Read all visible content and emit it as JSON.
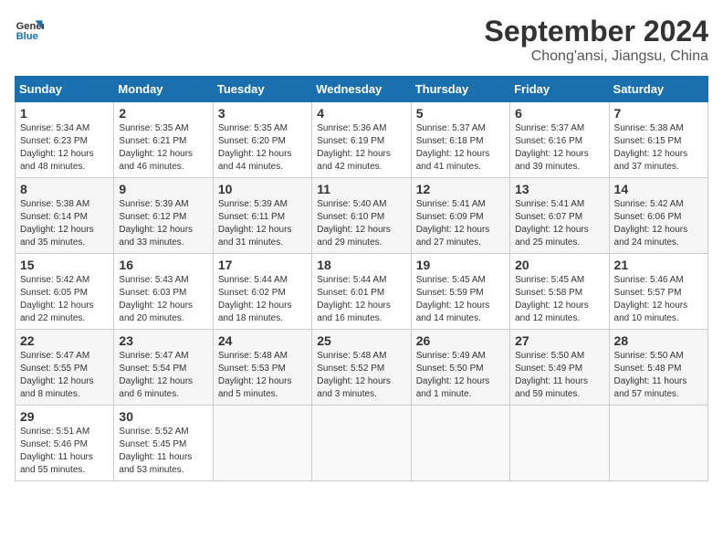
{
  "logo": {
    "line1": "General",
    "line2": "Blue"
  },
  "title": "September 2024",
  "location": "Chong'ansi, Jiangsu, China",
  "weekdays": [
    "Sunday",
    "Monday",
    "Tuesday",
    "Wednesday",
    "Thursday",
    "Friday",
    "Saturday"
  ],
  "weeks": [
    [
      {
        "day": "1",
        "info": "Sunrise: 5:34 AM\nSunset: 6:23 PM\nDaylight: 12 hours\nand 48 minutes."
      },
      {
        "day": "2",
        "info": "Sunrise: 5:35 AM\nSunset: 6:21 PM\nDaylight: 12 hours\nand 46 minutes."
      },
      {
        "day": "3",
        "info": "Sunrise: 5:35 AM\nSunset: 6:20 PM\nDaylight: 12 hours\nand 44 minutes."
      },
      {
        "day": "4",
        "info": "Sunrise: 5:36 AM\nSunset: 6:19 PM\nDaylight: 12 hours\nand 42 minutes."
      },
      {
        "day": "5",
        "info": "Sunrise: 5:37 AM\nSunset: 6:18 PM\nDaylight: 12 hours\nand 41 minutes."
      },
      {
        "day": "6",
        "info": "Sunrise: 5:37 AM\nSunset: 6:16 PM\nDaylight: 12 hours\nand 39 minutes."
      },
      {
        "day": "7",
        "info": "Sunrise: 5:38 AM\nSunset: 6:15 PM\nDaylight: 12 hours\nand 37 minutes."
      }
    ],
    [
      {
        "day": "8",
        "info": "Sunrise: 5:38 AM\nSunset: 6:14 PM\nDaylight: 12 hours\nand 35 minutes."
      },
      {
        "day": "9",
        "info": "Sunrise: 5:39 AM\nSunset: 6:12 PM\nDaylight: 12 hours\nand 33 minutes."
      },
      {
        "day": "10",
        "info": "Sunrise: 5:39 AM\nSunset: 6:11 PM\nDaylight: 12 hours\nand 31 minutes."
      },
      {
        "day": "11",
        "info": "Sunrise: 5:40 AM\nSunset: 6:10 PM\nDaylight: 12 hours\nand 29 minutes."
      },
      {
        "day": "12",
        "info": "Sunrise: 5:41 AM\nSunset: 6:09 PM\nDaylight: 12 hours\nand 27 minutes."
      },
      {
        "day": "13",
        "info": "Sunrise: 5:41 AM\nSunset: 6:07 PM\nDaylight: 12 hours\nand 25 minutes."
      },
      {
        "day": "14",
        "info": "Sunrise: 5:42 AM\nSunset: 6:06 PM\nDaylight: 12 hours\nand 24 minutes."
      }
    ],
    [
      {
        "day": "15",
        "info": "Sunrise: 5:42 AM\nSunset: 6:05 PM\nDaylight: 12 hours\nand 22 minutes."
      },
      {
        "day": "16",
        "info": "Sunrise: 5:43 AM\nSunset: 6:03 PM\nDaylight: 12 hours\nand 20 minutes."
      },
      {
        "day": "17",
        "info": "Sunrise: 5:44 AM\nSunset: 6:02 PM\nDaylight: 12 hours\nand 18 minutes."
      },
      {
        "day": "18",
        "info": "Sunrise: 5:44 AM\nSunset: 6:01 PM\nDaylight: 12 hours\nand 16 minutes."
      },
      {
        "day": "19",
        "info": "Sunrise: 5:45 AM\nSunset: 5:59 PM\nDaylight: 12 hours\nand 14 minutes."
      },
      {
        "day": "20",
        "info": "Sunrise: 5:45 AM\nSunset: 5:58 PM\nDaylight: 12 hours\nand 12 minutes."
      },
      {
        "day": "21",
        "info": "Sunrise: 5:46 AM\nSunset: 5:57 PM\nDaylight: 12 hours\nand 10 minutes."
      }
    ],
    [
      {
        "day": "22",
        "info": "Sunrise: 5:47 AM\nSunset: 5:55 PM\nDaylight: 12 hours\nand 8 minutes."
      },
      {
        "day": "23",
        "info": "Sunrise: 5:47 AM\nSunset: 5:54 PM\nDaylight: 12 hours\nand 6 minutes."
      },
      {
        "day": "24",
        "info": "Sunrise: 5:48 AM\nSunset: 5:53 PM\nDaylight: 12 hours\nand 5 minutes."
      },
      {
        "day": "25",
        "info": "Sunrise: 5:48 AM\nSunset: 5:52 PM\nDaylight: 12 hours\nand 3 minutes."
      },
      {
        "day": "26",
        "info": "Sunrise: 5:49 AM\nSunset: 5:50 PM\nDaylight: 12 hours\nand 1 minute."
      },
      {
        "day": "27",
        "info": "Sunrise: 5:50 AM\nSunset: 5:49 PM\nDaylight: 11 hours\nand 59 minutes."
      },
      {
        "day": "28",
        "info": "Sunrise: 5:50 AM\nSunset: 5:48 PM\nDaylight: 11 hours\nand 57 minutes."
      }
    ],
    [
      {
        "day": "29",
        "info": "Sunrise: 5:51 AM\nSunset: 5:46 PM\nDaylight: 11 hours\nand 55 minutes."
      },
      {
        "day": "30",
        "info": "Sunrise: 5:52 AM\nSunset: 5:45 PM\nDaylight: 11 hours\nand 53 minutes."
      },
      {
        "day": "",
        "info": ""
      },
      {
        "day": "",
        "info": ""
      },
      {
        "day": "",
        "info": ""
      },
      {
        "day": "",
        "info": ""
      },
      {
        "day": "",
        "info": ""
      }
    ]
  ]
}
